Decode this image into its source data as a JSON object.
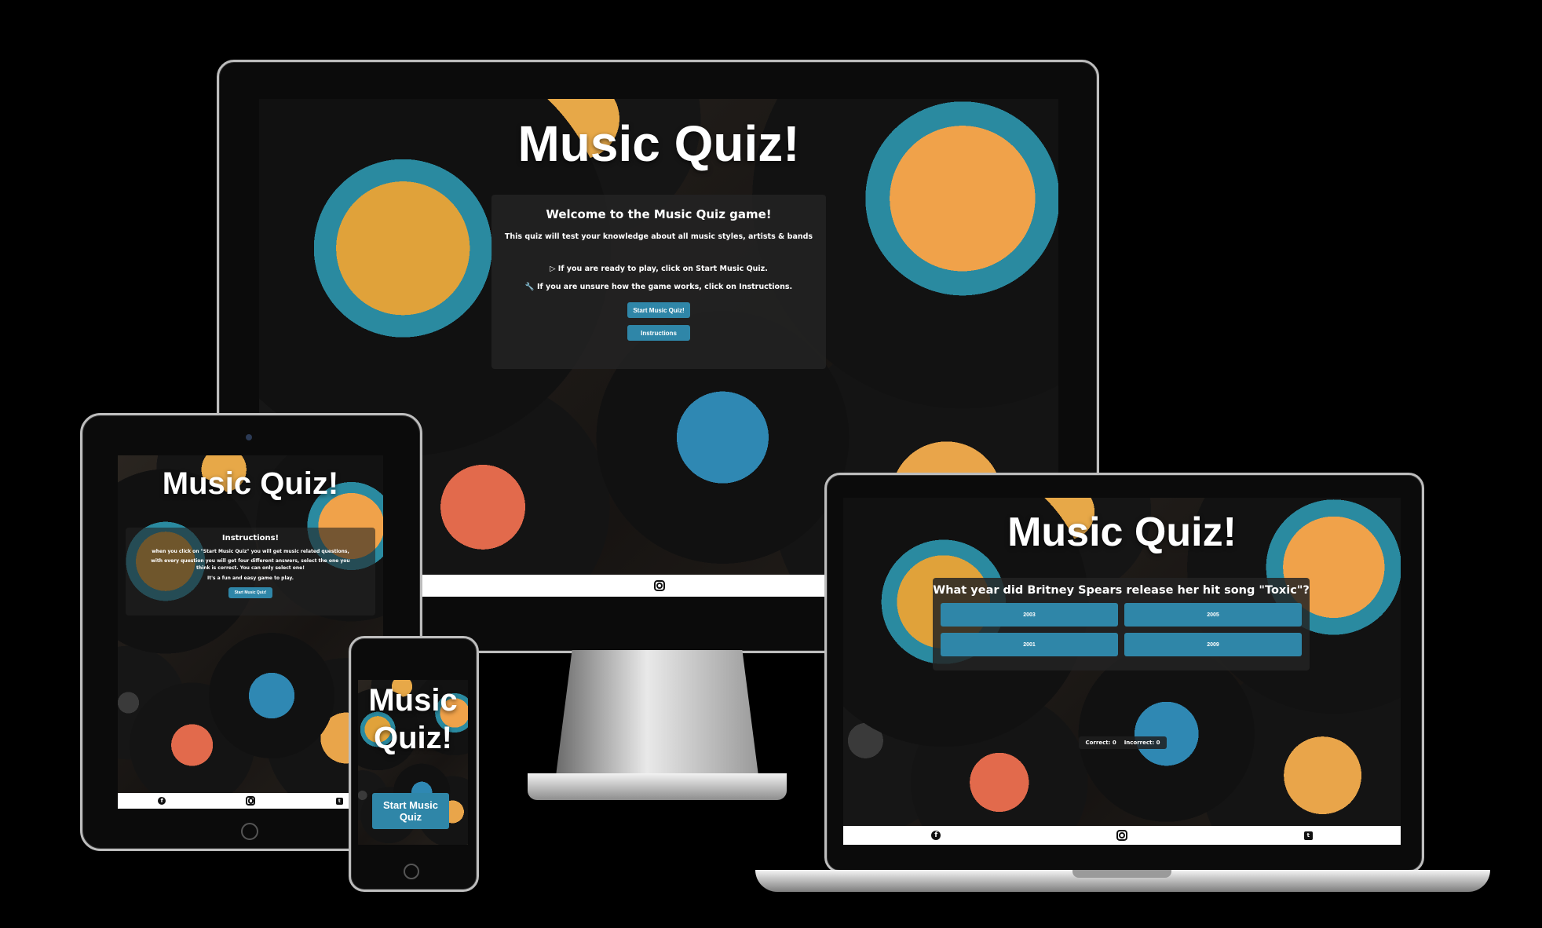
{
  "desktop": {
    "title": "Music Quiz!",
    "welcome_heading": "Welcome to the Music Quiz game!",
    "welcome_text": "This quiz will test your knowledge about all music styles, artists & bands",
    "ready_text": "▷ If you are ready to play, click on Start Music Quiz.",
    "unsure_text": "🔧 If you are unsure how the game works, click on Instructions.",
    "start_button": "Start Music Quiz!",
    "instructions_button": "Instructions"
  },
  "tablet": {
    "title": "Music Quiz!",
    "instructions_heading": "Instructions!",
    "instructions_line1": "when you click on \"Start Music Quiz\" you will get music related questions,",
    "instructions_line2": "with every question you will get four different answers, select the one you think is correct. You can only select one!",
    "instructions_line3": "It's a fun and easy game to play.",
    "start_button": "Start Music Quiz!"
  },
  "phone": {
    "title_line1": "Music",
    "title_line2": "Quiz!",
    "start_button": "Start Music Quiz"
  },
  "laptop": {
    "title": "Music Quiz!",
    "question": "What year did Britney Spears release her hit song \"Toxic\"?",
    "answers": [
      "2003",
      "2005",
      "2001",
      "2009"
    ],
    "correct_label": "Correct: 0",
    "incorrect_label": "Incorrect: 0"
  },
  "footer_icons": [
    "facebook-icon",
    "instagram-icon",
    "twitter-icon"
  ],
  "colors": {
    "accent": "#2f86a8",
    "background": "#000000",
    "footer": "#ffffff"
  }
}
